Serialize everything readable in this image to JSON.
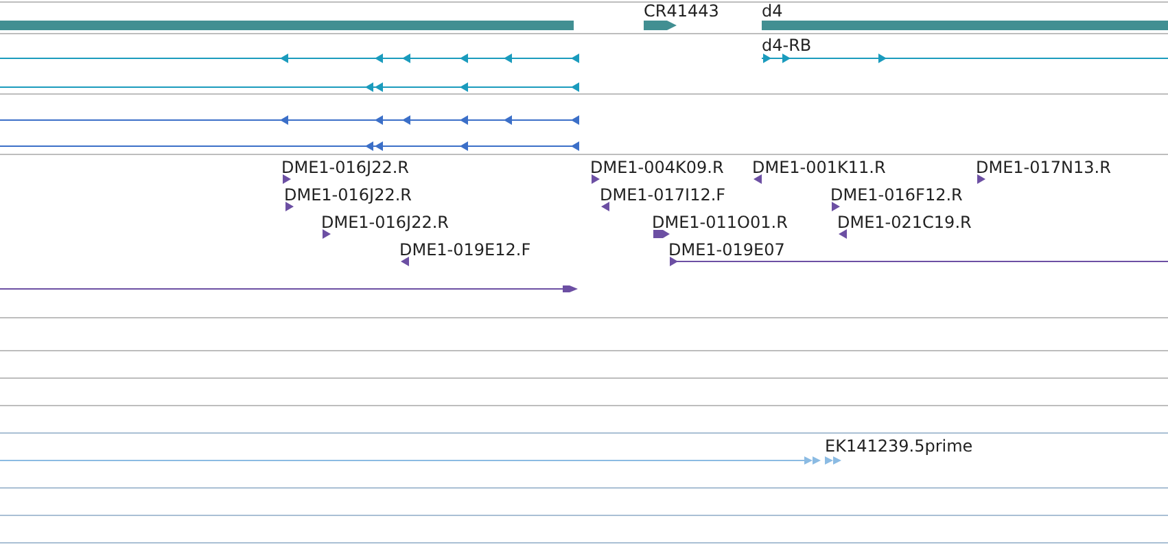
{
  "tracks": [
    {
      "kind": "genes",
      "features": [
        {
          "kind": "bar"
        },
        {
          "label": "CR41443",
          "kind": "forward"
        },
        {
          "label": "d4",
          "kind": "bar"
        }
      ]
    },
    {
      "kind": "transcripts",
      "features": [
        {
          "kind": "reverse"
        },
        {
          "kind": "reverse"
        },
        {
          "label": "d4-RB",
          "kind": "forward"
        }
      ]
    },
    {
      "kind": "transcripts",
      "features": [
        {
          "kind": "reverse"
        },
        {
          "kind": "reverse"
        }
      ]
    },
    {
      "kind": "ests",
      "features": [
        {
          "label": "DME1-016J22.R",
          "kind": "forward"
        },
        {
          "label": "DME1-016J22.R",
          "kind": "forward"
        },
        {
          "label": "DME1-016J22.R",
          "kind": "forward"
        },
        {
          "label": "DME1-019E12.F",
          "kind": "reverse"
        },
        {
          "label": "DME1-004K09.R",
          "kind": "forward"
        },
        {
          "label": "DME1-017I12.F",
          "kind": "reverse"
        },
        {
          "label": "DME1-011O01.R",
          "kind": "forward"
        },
        {
          "label": "DME1-019E07",
          "kind": "forward"
        },
        {
          "label": "DME1-001K11.R",
          "kind": "reverse"
        },
        {
          "label": "DME1-016F12.R",
          "kind": "forward"
        },
        {
          "label": "DME1-021C19.R",
          "kind": "reverse"
        },
        {
          "label": "DME1-017N13.R",
          "kind": "forward"
        },
        {
          "kind": "forward"
        }
      ]
    },
    {
      "kind": "ests",
      "features": [
        {
          "label": "EK141239.5prime",
          "kind": "forward"
        }
      ]
    }
  ]
}
